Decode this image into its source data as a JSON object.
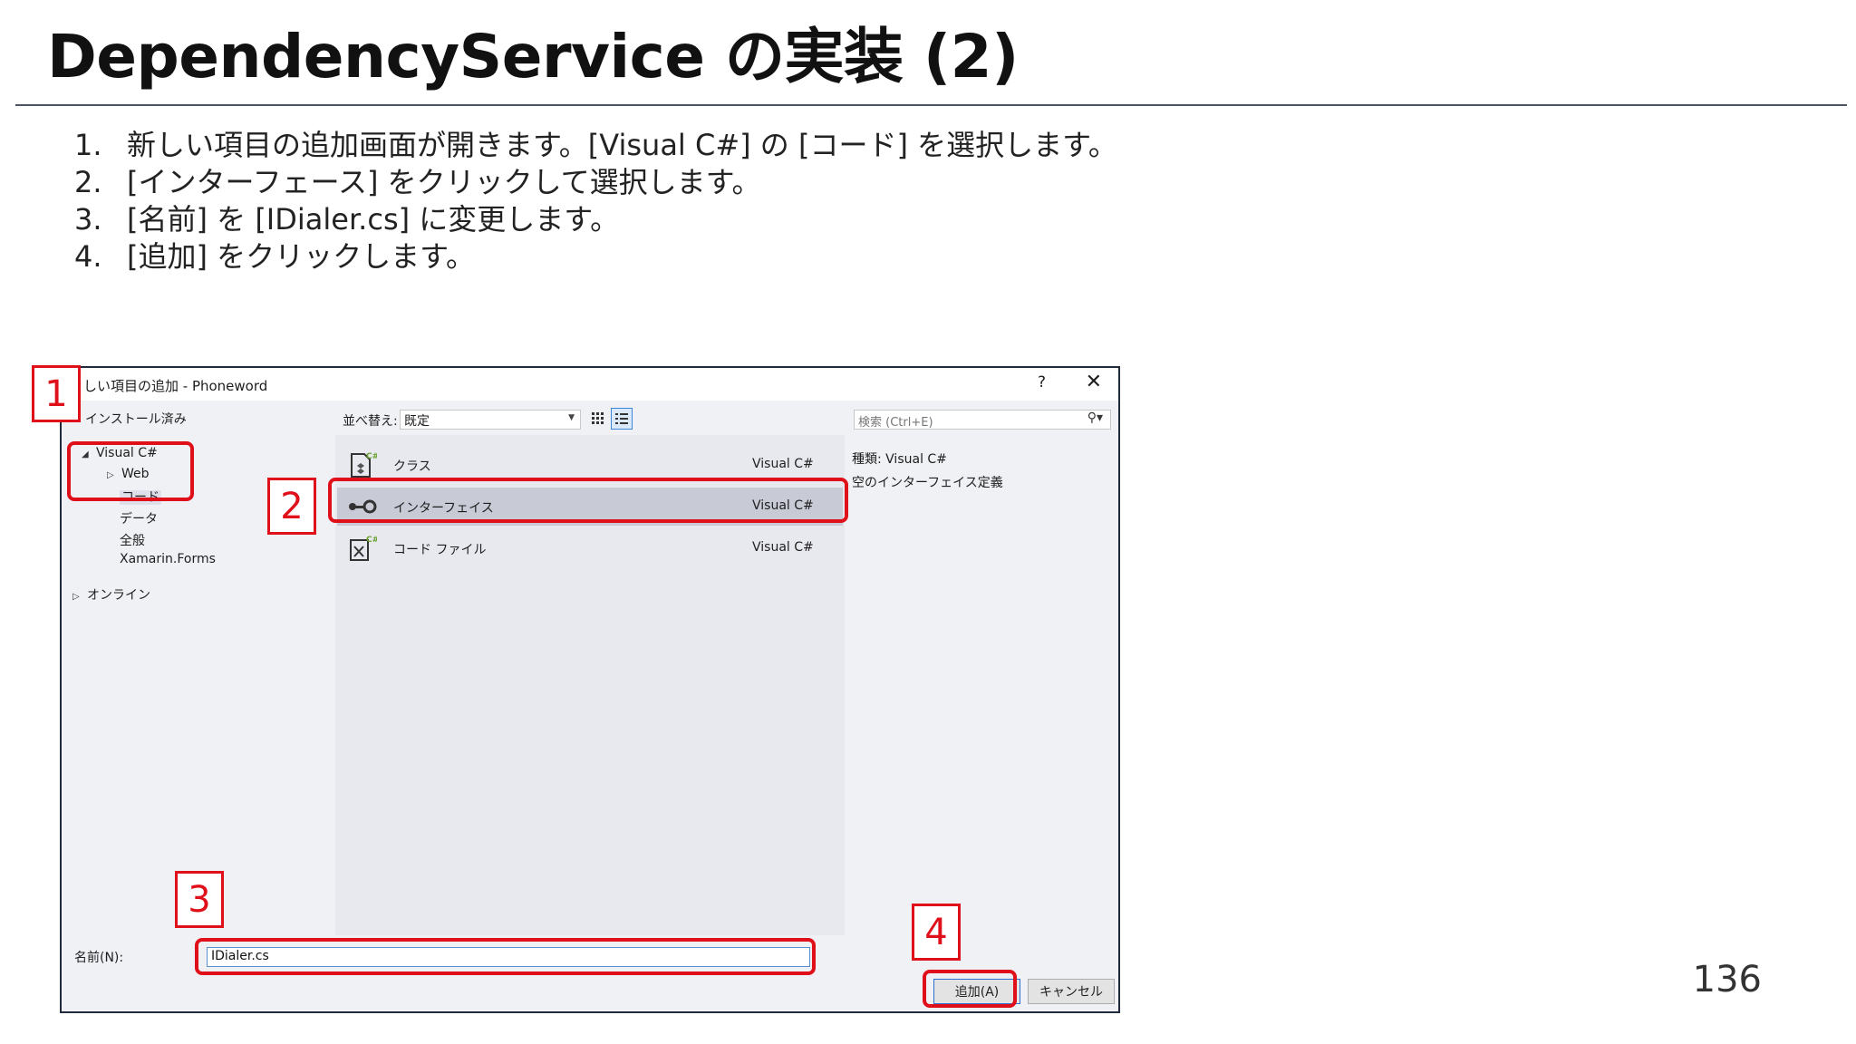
{
  "slide": {
    "title": "DependencyService の実装 (2)",
    "steps": [
      {
        "num": "1.",
        "text": "新しい項目の追加画面が開きます。[Visual C#] の [コード] を選択します。"
      },
      {
        "num": "2.",
        "text": "[インターフェース] をクリックして選択します。"
      },
      {
        "num": "3.",
        "text": "[名前] を [IDialer.cs] に変更します。"
      },
      {
        "num": "4.",
        "text": "[追加] をクリックします。"
      }
    ],
    "page_number": "136"
  },
  "dialog": {
    "title": "しい項目の追加 - Phoneword",
    "help": "?",
    "close": "✕",
    "tree": {
      "header": "インストール済み",
      "items": {
        "visual_cs": "Visual C#",
        "web": "Web",
        "code": "コード",
        "data": "データ",
        "general": "全般",
        "xamarin": "Xamarin.Forms",
        "online": "オンライン"
      }
    },
    "sort": {
      "label": "並べ替え:",
      "value": "既定"
    },
    "templates": [
      {
        "name": "クラス",
        "lang": "Visual C#"
      },
      {
        "name": "インターフェイス",
        "lang": "Visual C#"
      },
      {
        "name": "コード ファイル",
        "lang": "Visual C#"
      }
    ],
    "search": {
      "placeholder": "検索 (Ctrl+E)"
    },
    "details": {
      "type": "種類:  Visual C#",
      "description": "空のインターフェイス定義"
    },
    "name": {
      "label": "名前(N):",
      "value": "IDialer.cs"
    },
    "buttons": {
      "add": "追加(A)",
      "cancel": "キャンセル"
    }
  },
  "callouts": [
    "1",
    "2",
    "3",
    "4"
  ],
  "colors": {
    "callout": "#e0101a",
    "selection": "#c8cad6",
    "csharp_badge": "#68a12e"
  }
}
